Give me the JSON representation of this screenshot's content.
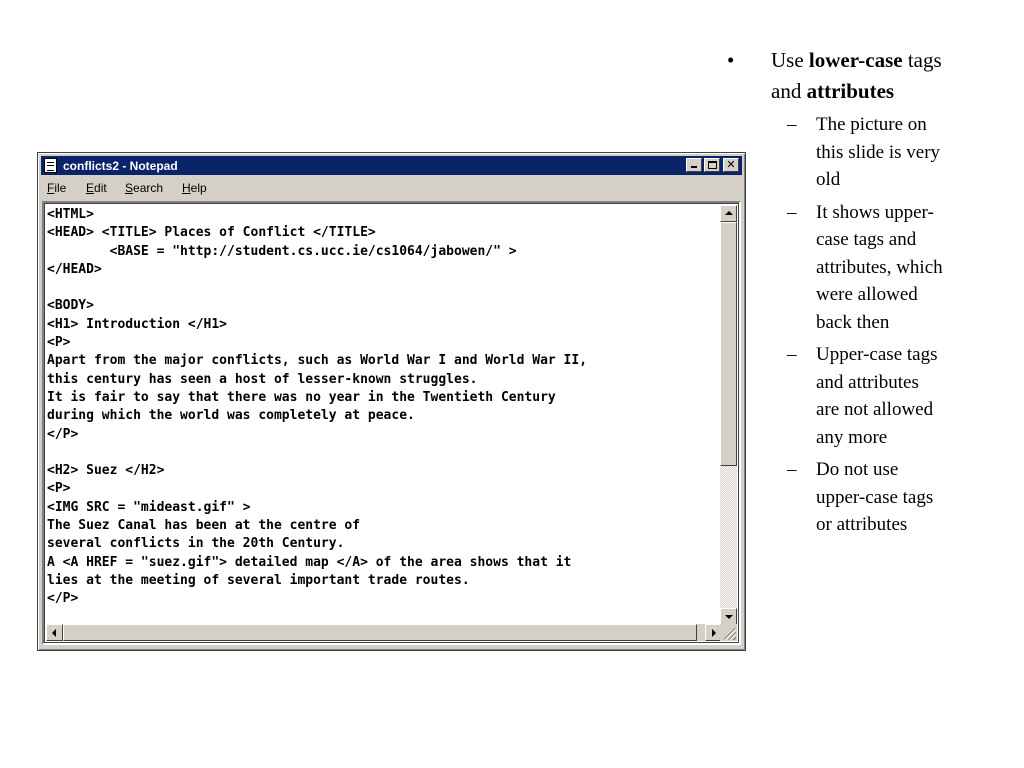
{
  "window": {
    "title": "conflicts2 - Notepad",
    "buttons": {
      "minimize": "_",
      "maximize": "□",
      "close": "✕"
    }
  },
  "menu": [
    {
      "label": "File",
      "accel": "F",
      "rest": "ile"
    },
    {
      "label": "Edit",
      "accel": "E",
      "rest": "dit"
    },
    {
      "label": "Search",
      "accel": "S",
      "rest": "earch"
    },
    {
      "label": "Help",
      "accel": "H",
      "rest": "elp"
    }
  ],
  "editor": {
    "lines": [
      "<HTML>",
      "<HEAD> <TITLE> Places of Conflict </TITLE>",
      "        <BASE = \"http://student.cs.ucc.ie/cs1064/jabowen/\" >",
      "</HEAD>",
      "",
      "<BODY>",
      "<H1> Introduction </H1>",
      "<P>",
      "Apart from the major conflicts, such as World War I and World War II,",
      "this century has seen a host of lesser-known struggles.",
      "It is fair to say that there was no year in the Twentieth Century",
      "during which the world was completely at peace.",
      "</P>",
      "",
      "<H2> Suez </H2>",
      "<P>",
      "<IMG SRC = \"mideast.gif\" >",
      "The Suez Canal has been at the centre of",
      "several conflicts in the 20th Century.",
      "A <A HREF = \"suez.gif\"> detailed map </A> of the area shows that it",
      "lies at the meeting of several important trade routes.",
      "</P>"
    ]
  },
  "slide": {
    "bullet_symbol": "•",
    "bullet": {
      "pre": "Use ",
      "bold1": "lower-case",
      "mid": " tags and ",
      "bold2": "attributes"
    },
    "sub_symbol": "–",
    "sub_points": [
      "The picture on this slide is very old",
      "It shows upper-case tags and attributes, which were allowed back then",
      "Upper-case tags and attributes are not allowed any more",
      "Do not use upper-case tags or attributes"
    ]
  }
}
